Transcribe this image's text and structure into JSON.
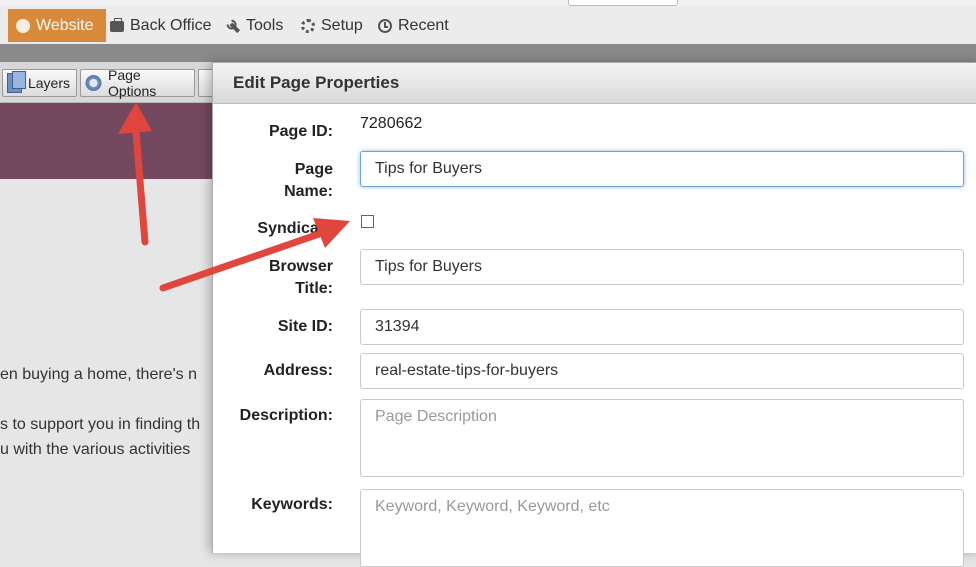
{
  "menu": {
    "items": [
      {
        "label": "Website",
        "icon": "globe-icon",
        "active": true
      },
      {
        "label": "Back Office",
        "icon": "briefcase-icon"
      },
      {
        "label": "Tools",
        "icon": "wrench-icon"
      },
      {
        "label": "Setup",
        "icon": "gear-icon"
      },
      {
        "label": "Recent",
        "icon": "clock-icon"
      }
    ]
  },
  "toolbar": {
    "layers_label": "Layers",
    "page_options_label": "Page Options"
  },
  "content": {
    "line1": "en buying a home, there's n",
    "line2": "s to support you in finding th",
    "line3": "u with the various activities"
  },
  "dialog": {
    "title": "Edit Page Properties",
    "page_id_label": "Page ID:",
    "page_id_value": "7280662",
    "page_name_label_1": "Page",
    "page_name_label_2": "Name:",
    "page_name_value": "Tips for Buyers",
    "syndicate_label": "Syndicate",
    "syndicate_checked": false,
    "browser_title_label_1": "Browser",
    "browser_title_label_2": "Title:",
    "browser_title_value": "Tips for Buyers",
    "site_id_label": "Site ID:",
    "site_id_value": "31394",
    "address_label": "Address:",
    "address_value": "real-estate-tips-for-buyers",
    "description_label": "Description:",
    "description_placeholder": "Page Description",
    "keywords_label": "Keywords:",
    "keywords_placeholder": "Keyword, Keyword, Keyword, etc"
  },
  "colors": {
    "menu_active": "#d9893a",
    "banner": "#74485f",
    "annotation_arrow": "#e0453e",
    "focus_ring": "#6ea3d8"
  }
}
